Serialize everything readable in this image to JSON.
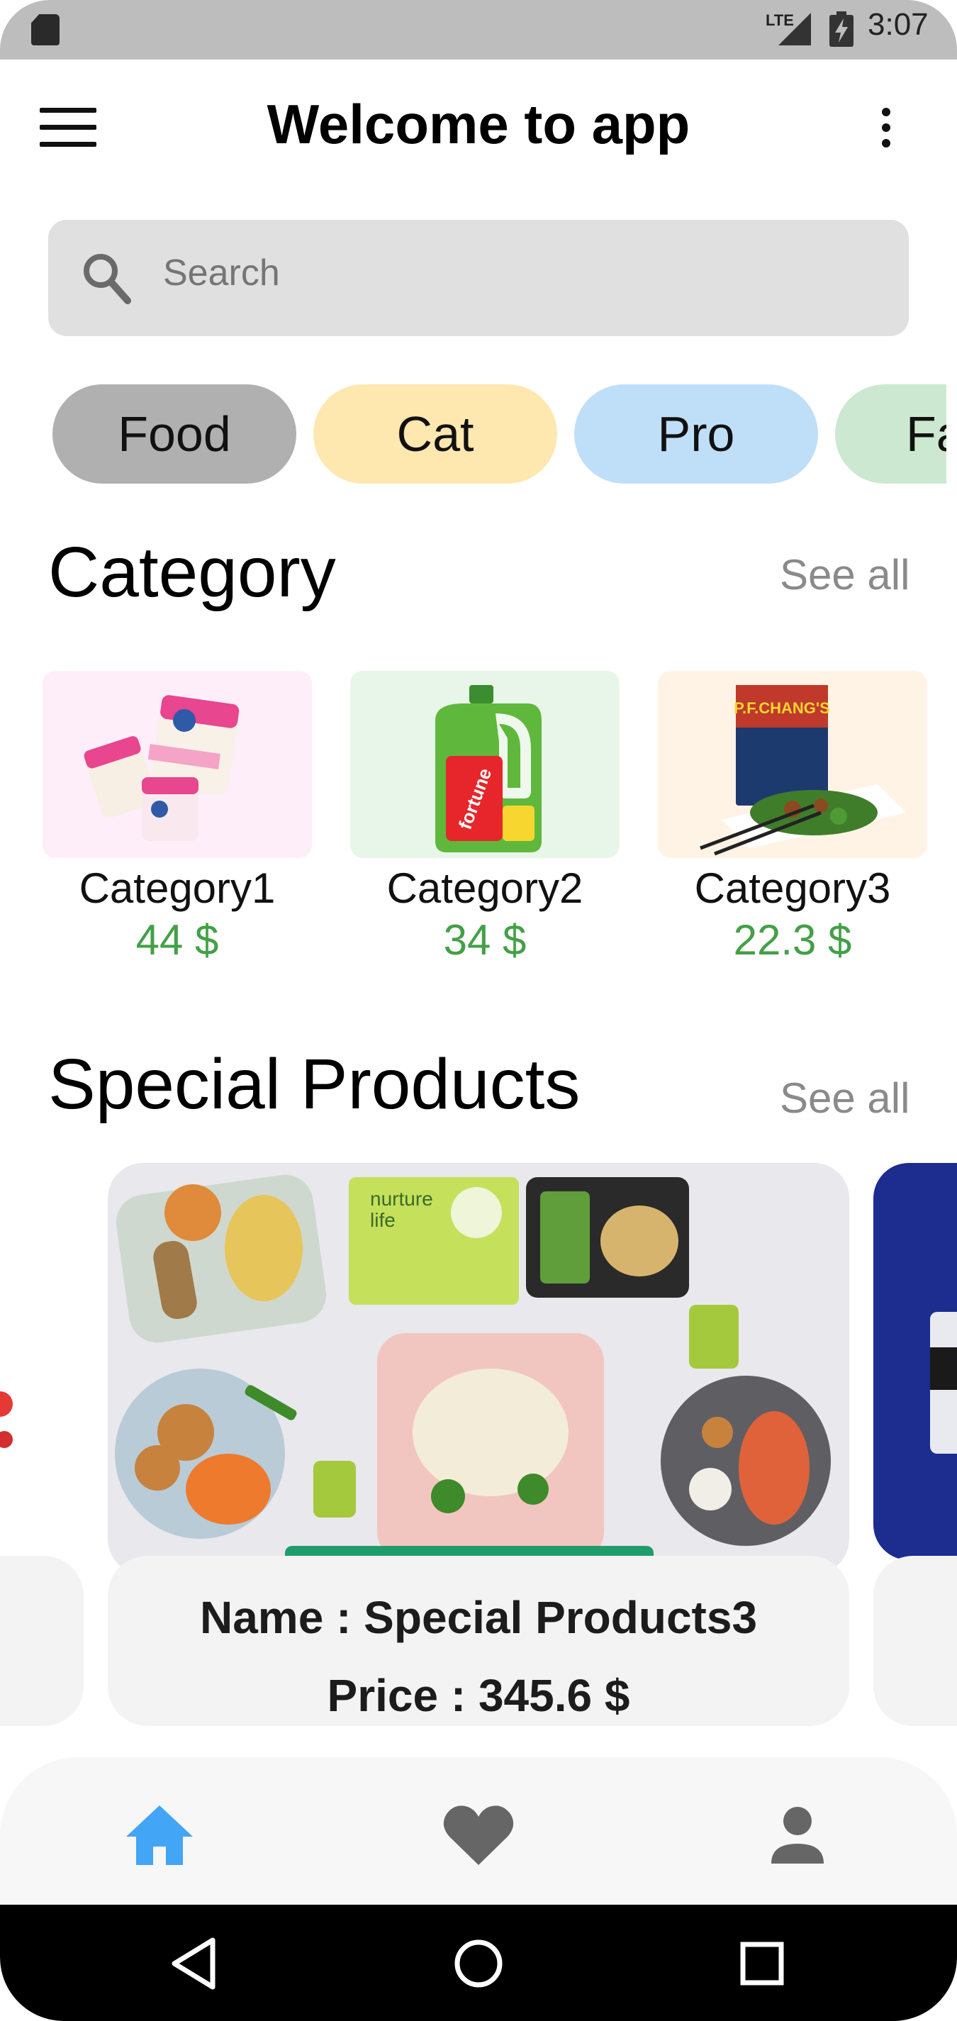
{
  "status_bar": {
    "network": "LTE",
    "time": "3:07",
    "icons": [
      "sd-card-icon",
      "signal-icon",
      "battery-charging-icon"
    ]
  },
  "app_bar": {
    "title": "Welcome to app",
    "menu_icon": "menu-icon",
    "more_icon": "more-vert-icon"
  },
  "search": {
    "placeholder": "Search",
    "icon": "search-icon"
  },
  "chips": [
    {
      "label": "Food",
      "color": "#b0b0b0"
    },
    {
      "label": "Cat",
      "color": "#ffe7b0"
    },
    {
      "label": "Pro",
      "color": "#bfdff8"
    },
    {
      "label": "Fa",
      "color": "#cde8d0"
    }
  ],
  "category_section": {
    "title": "Category",
    "see_all": "See all",
    "items": [
      {
        "name": "Category1",
        "price": "44 $",
        "image": "ice-cream-tubs",
        "bg": "#fdeefa"
      },
      {
        "name": "Category2",
        "price": "34 $",
        "image": "oil-jug",
        "bg": "#e8f6ea"
      },
      {
        "name": "Category3",
        "price": "22.3 $",
        "image": "stir-fry-box",
        "bg": "#fff3e6"
      }
    ]
  },
  "special_section": {
    "title": "Special Products",
    "see_all": "See all",
    "featured": {
      "name_line": "Name : Special Products3",
      "price_line": "Price :  345.6 $",
      "image": "meal-kit-trays"
    }
  },
  "bottom_nav": {
    "items": [
      {
        "icon": "home-icon",
        "active": true
      },
      {
        "icon": "heart-icon",
        "active": false
      },
      {
        "icon": "person-icon",
        "active": false
      }
    ],
    "active_color": "#42a5f5",
    "inactive_color": "#666666"
  },
  "system_nav": [
    "back-icon",
    "home-circle-icon",
    "recents-icon"
  ],
  "colors": {
    "price_green": "#43a047",
    "see_all_gray": "#8a8a8a"
  }
}
